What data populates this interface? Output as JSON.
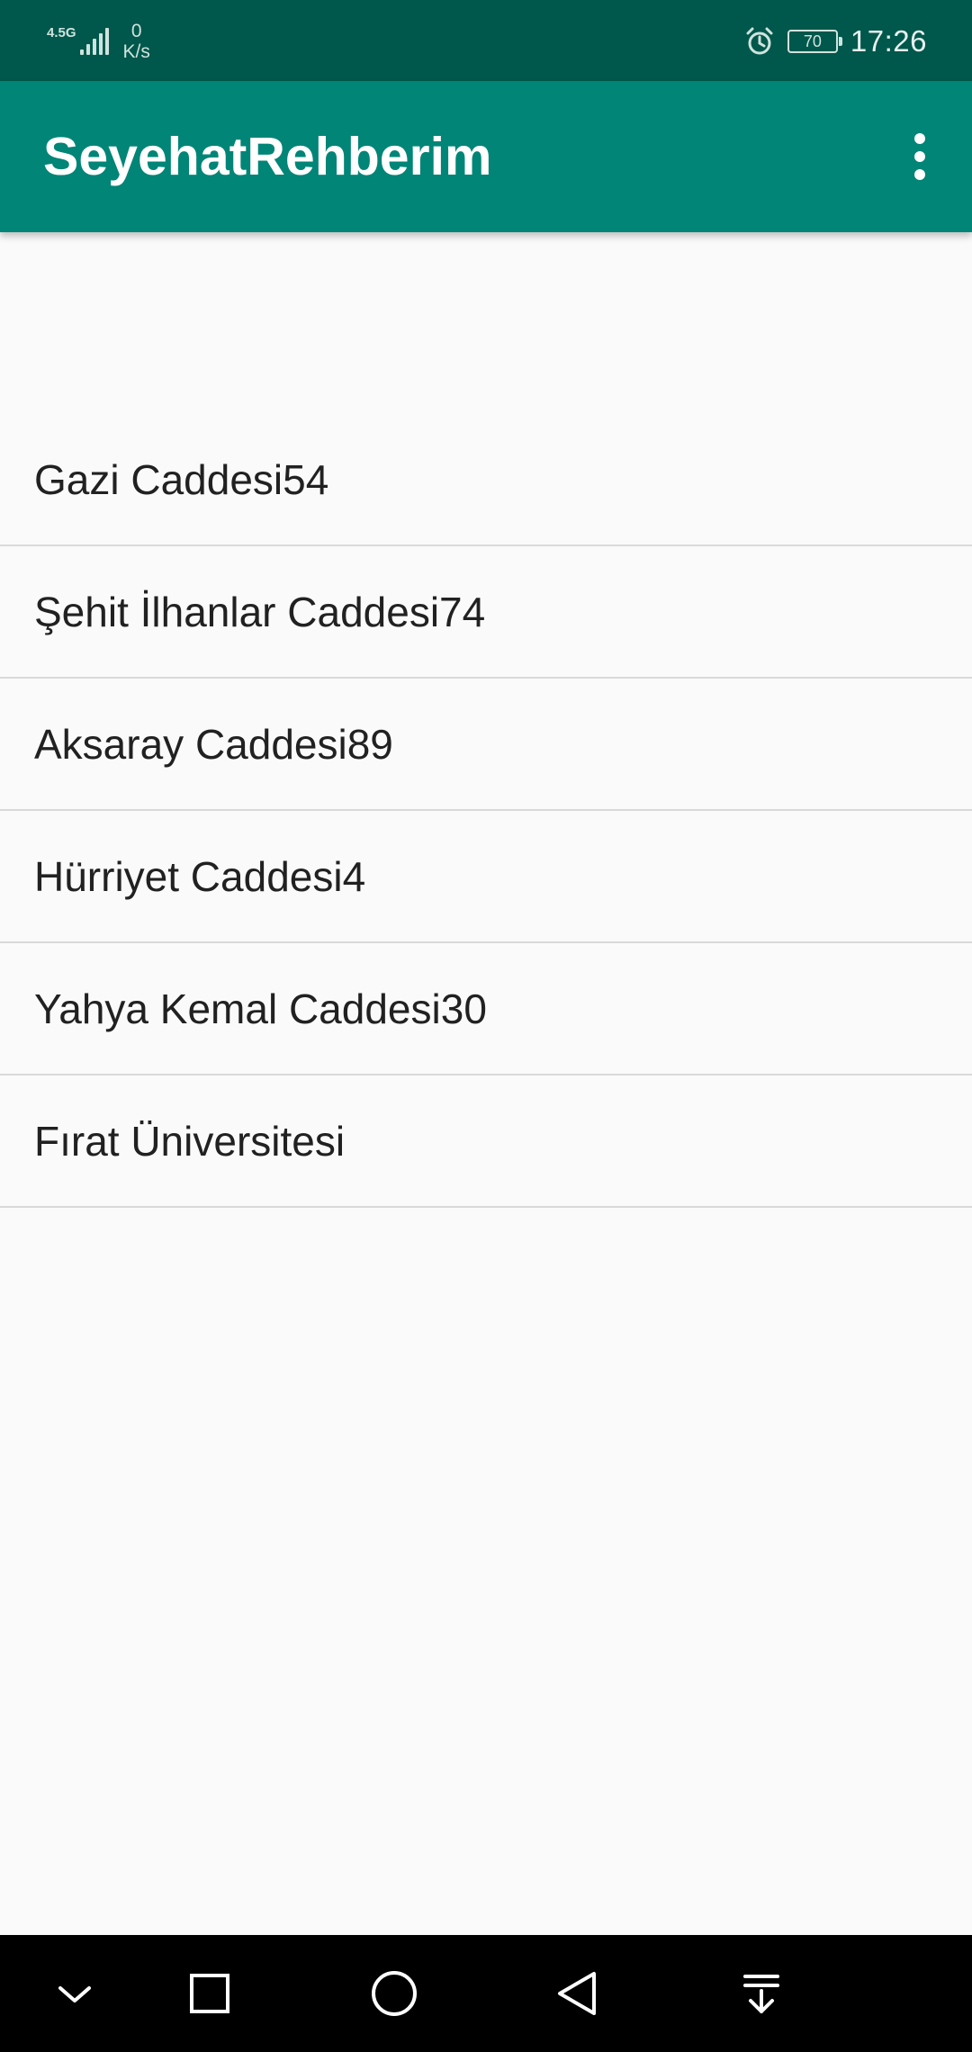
{
  "status_bar": {
    "network_type": "4.5G",
    "net_speed_value": "0",
    "net_speed_unit": "K/s",
    "battery_level": "70",
    "time": "17:26",
    "icons": [
      "signal-icon",
      "alarm-icon",
      "battery-icon"
    ]
  },
  "app_bar": {
    "title": "SeyehatRehberim",
    "menu_icon": "overflow-menu-icon"
  },
  "places": [
    {
      "label": "Gazi Caddesi54"
    },
    {
      "label": "Şehit İlhanlar Caddesi74"
    },
    {
      "label": "Aksaray Caddesi89"
    },
    {
      "label": "Hürriyet Caddesi4"
    },
    {
      "label": "Yahya Kemal Caddesi30"
    },
    {
      "label": "Fırat Üniversitesi"
    }
  ],
  "nav_bar": {
    "buttons": [
      "collapse-icon",
      "recents-icon",
      "home-icon",
      "back-icon",
      "notification-pulldown-icon"
    ]
  },
  "colors": {
    "status_bar": "#00574b",
    "app_bar": "#008577",
    "background": "#fafafa",
    "divider": "#d9d9d9",
    "text": "#212121"
  }
}
